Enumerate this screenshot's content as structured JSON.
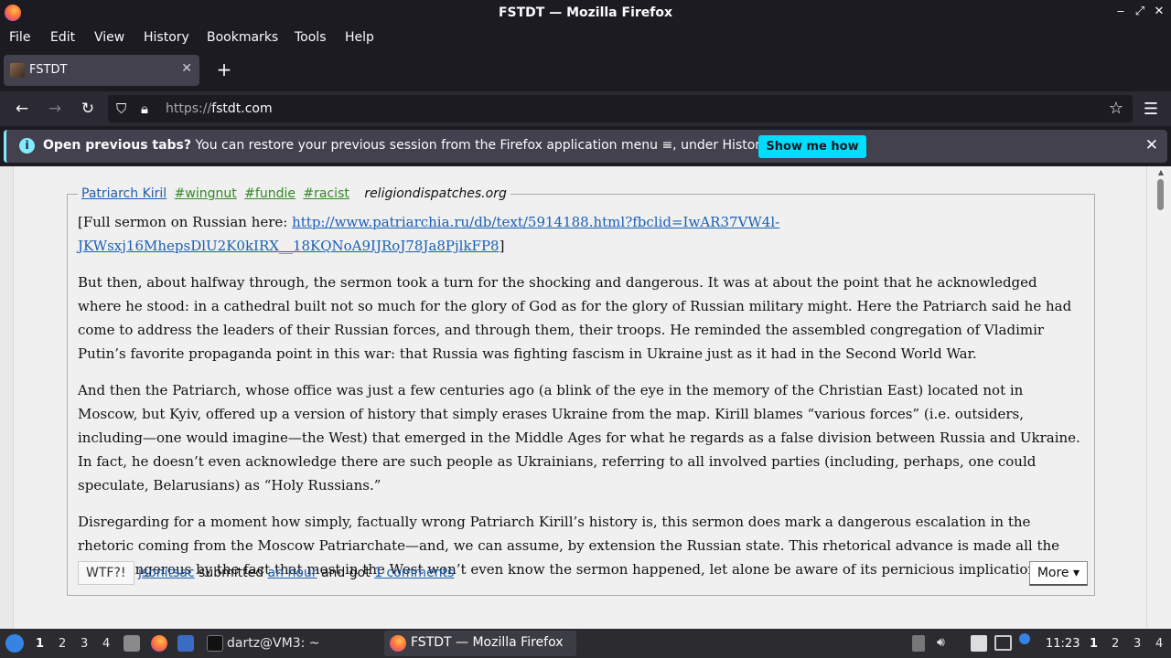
{
  "window": {
    "title": "FSTDT — Mozilla Firefox"
  },
  "menu": [
    "File",
    "Edit",
    "View",
    "History",
    "Bookmarks",
    "Tools",
    "Help"
  ],
  "tab": {
    "title": "FSTDT"
  },
  "urlbar": {
    "scheme": "https://",
    "host": "fstdt.com"
  },
  "notification": {
    "bold": "Open previous tabs?",
    "text": " You can restore your previous session from the Firefox application menu ≡, under History.",
    "button": "Show me how"
  },
  "quote": {
    "person": "Patriarch Kiril",
    "tags": [
      "#wingnut",
      "#fundie",
      "#racist"
    ],
    "source": "religiondispatches.org",
    "p1_prefix": "[Full sermon on Russian here: ",
    "p1_link": "http://www.patriarchia.ru/db/text/5914188.html?fbclid=IwAR37VW4l-JKWsxj16MhepsDlU2K0kIRX__18KQNoA9IJRoJ78Ja8PjlkFP8",
    "p1_suffix": "]",
    "p2": "But then, about halfway through, the sermon took a turn for the shocking and dangerous. It was at about the point that he acknowledged where he stood: in a cathedral built not so much for the glory of God as for the glory of Russian military might. Here the Patriarch said he had come to address the leaders of their Russian forces, and through them, their troops. He reminded the assembled congregation of Vladimir Putin’s favorite propaganda point in this war: that Russia was fighting fascism in Ukraine just as it had in the Second World War.",
    "p3": "And then the Patriarch, whose office was just a few centuries ago (a blink of the eye in the memory of the Christian East) located not in Moscow, but Kyiv, offered up a version of history that simply erases Ukraine from the map. Kirill blames “various forces” (i.e. outsiders, including—one would imagine—the West) that emerged in the Middle Ages for what he regards as a false division between Russia and Ukraine. In fact, he doesn’t even acknowledge there are such people as Ukrainians, referring to all involved parties (including, perhaps, one could speculate, Belarusians) as “Holy Russians.”",
    "p4": "Disregarding for a moment how simply, factually wrong Patriarch Kirill’s history is, this sermon does mark a dangerous escalation in the rhetoric coming from the Moscow Patriarchate—and, we can assume, by extension the Russian state. This rhetorical advance is made all the more dangerous by the fact that most in the West won’t even know the sermon happened, let alone be aware of its pernicious implications."
  },
  "footer": {
    "wtf": "WTF?!",
    "user": "jsonitsac",
    "submitted": " submitted ",
    "time": "an hour",
    "got": " and got ",
    "comments": "1 comments",
    "more": "More ▾"
  },
  "taskbar": {
    "workspaces_left": [
      "1",
      "2",
      "3",
      "4"
    ],
    "terminal": "dartz@VM3: ~",
    "firefox": "FSTDT — Mozilla Firefox",
    "clock": "11:23",
    "workspaces_right": [
      "1",
      "2",
      "3",
      "4"
    ]
  },
  "colors": {
    "accent": "#00ddff",
    "link": "#1a5fb4",
    "tag": "#2e8b1e"
  }
}
